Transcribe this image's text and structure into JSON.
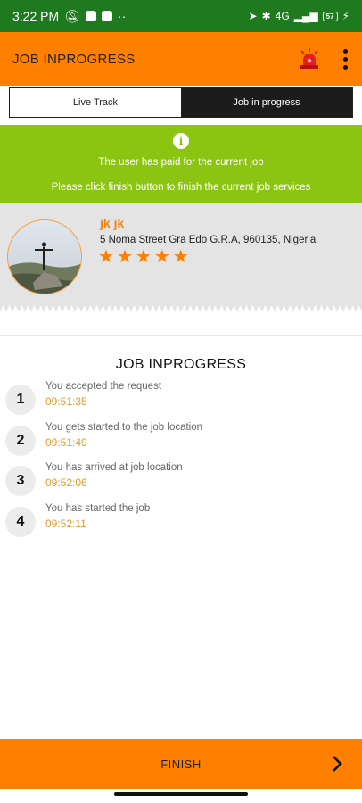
{
  "status_bar": {
    "time": "3:22 PM",
    "network": "4G",
    "battery": "57"
  },
  "app_bar": {
    "title": "JOB INPROGRESS",
    "icons": [
      "siren-icon",
      "more-vert-icon"
    ]
  },
  "tabs": [
    {
      "label": "Live Track",
      "active": false
    },
    {
      "label": "Job in progress",
      "active": true
    }
  ],
  "banner": {
    "line1": "The user has paid for the current job",
    "line2": "Please click finish button to finish the current job services",
    "color": "#8cc511"
  },
  "user": {
    "name": "jk jk",
    "address": "5 Noma Street Gra Edo G.R.A, 960135, Nigeria",
    "rating": 5
  },
  "timeline": {
    "title": "JOB INPROGRESS",
    "steps": [
      {
        "num": "1",
        "text": "You accepted the request",
        "time": "09:51:35"
      },
      {
        "num": "2",
        "text": "You gets started to the job location",
        "time": "09:51:49"
      },
      {
        "num": "3",
        "text": "You has arrived at job location",
        "time": "09:52:06"
      },
      {
        "num": "4",
        "text": "You has started the job",
        "time": "09:52:11"
      }
    ]
  },
  "footer": {
    "finish_label": "FINISH"
  },
  "colors": {
    "accent": "#ff7f00",
    "status_bar": "#1f7a1f",
    "time_text": "#e39a26"
  }
}
